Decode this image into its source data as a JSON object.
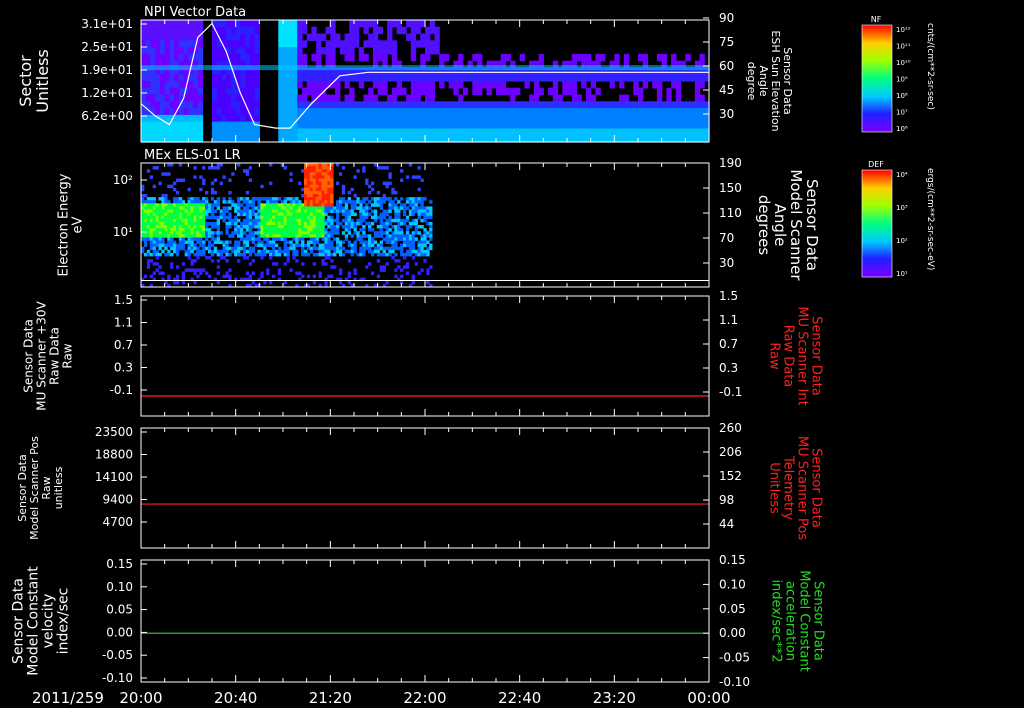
{
  "panels": [
    {
      "title": "NPI Vector Data",
      "left_label": [
        "Sector",
        "Unitless"
      ],
      "right_label": [
        "Sensor Data",
        "ESH Sun Elevation",
        "Angle",
        "degree"
      ],
      "left_ticks": [
        "3.1e+01",
        "2.5e+01",
        "1.9e+01",
        "1.2e+01",
        "6.2e+00"
      ],
      "right_ticks": [
        "90",
        "75",
        "60",
        "45",
        "30"
      ],
      "colorbar_title": "NF",
      "colorbar_ticks": [
        "10¹²",
        "10¹¹",
        "10¹⁰",
        "10⁹",
        "10⁸",
        "10⁷",
        "10⁶"
      ],
      "colorbar_units": "cnts/(cm**2-sr-sec)"
    },
    {
      "title": "MEx ELS-01 LR",
      "left_label": [
        "Electron Energy",
        "eV"
      ],
      "right_label": [
        "Sensor Data",
        "Model Scanner",
        "Angle",
        "degrees"
      ],
      "left_ticks": [
        "10²",
        "10¹"
      ],
      "right_ticks": [
        "190",
        "150",
        "110",
        "70",
        "30"
      ],
      "colorbar_title": "DEF",
      "colorbar_ticks": [
        "10⁴",
        "10³",
        "10²",
        "10¹"
      ],
      "colorbar_units": "ergs/(cm**2-sr-sec-eV)"
    },
    {
      "left_label": [
        "Sensor Data",
        "MU Scanner +30V",
        "Raw Data",
        "Raw"
      ],
      "right_label": [
        "Sensor Data",
        "MU Scanner Int",
        "Raw Data",
        "Raw"
      ],
      "left_ticks": [
        "1.5",
        "1.1",
        "0.7",
        "0.3",
        "-0.1"
      ],
      "right_ticks": [
        "1.5",
        "1.1",
        "0.7",
        "0.3",
        "-0.1"
      ]
    },
    {
      "left_label": [
        "Sensor Data",
        "Model Scanner Pos",
        "Raw",
        "unitless"
      ],
      "right_label": [
        "Sensor Data",
        "MU Scanner Pos",
        "Telemetry",
        "Unitless"
      ],
      "left_ticks": [
        "23500",
        "18800",
        "14100",
        "9400",
        "4700"
      ],
      "right_ticks": [
        "260",
        "206",
        "152",
        "98",
        "44"
      ]
    },
    {
      "left_label": [
        "Sensor Data",
        "Model Constant",
        "velocity",
        "index/sec"
      ],
      "right_label": [
        "Sensor Data",
        "Model Constant",
        "acceleration",
        "index/sec**2"
      ],
      "left_ticks": [
        "0.15",
        "0.10",
        "0.05",
        "0.00",
        "-0.05",
        "-0.10"
      ],
      "right_ticks": [
        "0.15",
        "0.10",
        "0.05",
        "0.00",
        "-0.05",
        "-0.10"
      ]
    }
  ],
  "time_axis": {
    "date": "2011/259",
    "labels": [
      "20:00",
      "20:40",
      "21:20",
      "22:00",
      "22:40",
      "23:20",
      "00:00"
    ]
  },
  "colors": {
    "background": "#000000",
    "frame": "#ffffff",
    "panel3_line": "#ff2020",
    "panel4_line": "#ff2020",
    "panel5_line": "#22dd22",
    "panel3_right_label": "#ff2020",
    "panel4_right_label": "#ff2020",
    "panel5_right_label": "#22dd22"
  },
  "chart_data": [
    {
      "type": "heatmap",
      "title": "NPI Vector Data",
      "xlabel": "",
      "ylabel": "Sector Unitless",
      "x": [
        "20:00",
        "20:40",
        "21:20",
        "22:00",
        "22:40",
        "23:20",
        "00:00"
      ],
      "y_ticks": [
        "3.1e+01",
        "2.5e+01",
        "1.9e+01",
        "1.2e+01",
        "6.2e+00"
      ],
      "colorbar": "NF cnts/(cm**2-sr-sec)",
      "data_gaps": [
        [
          20.42,
          20.49
        ],
        [
          20.82,
          20.97
        ]
      ],
      "overlay_line": {
        "axis": "right",
        "ylim": [
          20,
          90
        ],
        "x_hours": [
          20.0,
          20.1,
          20.2,
          20.3,
          20.4,
          20.5,
          20.6,
          20.7,
          20.8,
          20.95,
          21.05,
          21.2,
          21.4,
          21.6,
          22.2,
          24.0
        ],
        "y": [
          42,
          35,
          30,
          45,
          80,
          88,
          72,
          48,
          30,
          28,
          28,
          42,
          58,
          60,
          60,
          60
        ]
      }
    },
    {
      "type": "heatmap",
      "title": "MEx ELS-01 LR",
      "xlabel": "",
      "ylabel": "Electron Energy eV",
      "y_ticks": [
        "10²",
        "10¹"
      ],
      "colorbar": "DEF ergs/(cm**2-sr-sec-eV)",
      "data_end_hour": 22.05,
      "overlay_line": {
        "axis": "right",
        "ylim": [
          0,
          190
        ],
        "x_hours": [
          20.0,
          24.0
        ],
        "y": [
          10,
          10
        ]
      }
    },
    {
      "type": "line",
      "x_hours": [
        20.0,
        24.0
      ],
      "ylim": [
        -0.3,
        1.5
      ],
      "series": [
        {
          "values": [
            0.0,
            0.0
          ]
        }
      ]
    },
    {
      "type": "line",
      "x_hours": [
        20.0,
        24.0
      ],
      "ylim": [
        0,
        23500
      ],
      "series": [
        {
          "values": [
            8600,
            8600
          ]
        }
      ]
    },
    {
      "type": "line",
      "x_hours": [
        20.0,
        24.0
      ],
      "ylim": [
        -0.1,
        0.15
      ],
      "series": [
        {
          "values": [
            0.0,
            0.0
          ]
        }
      ]
    }
  ]
}
